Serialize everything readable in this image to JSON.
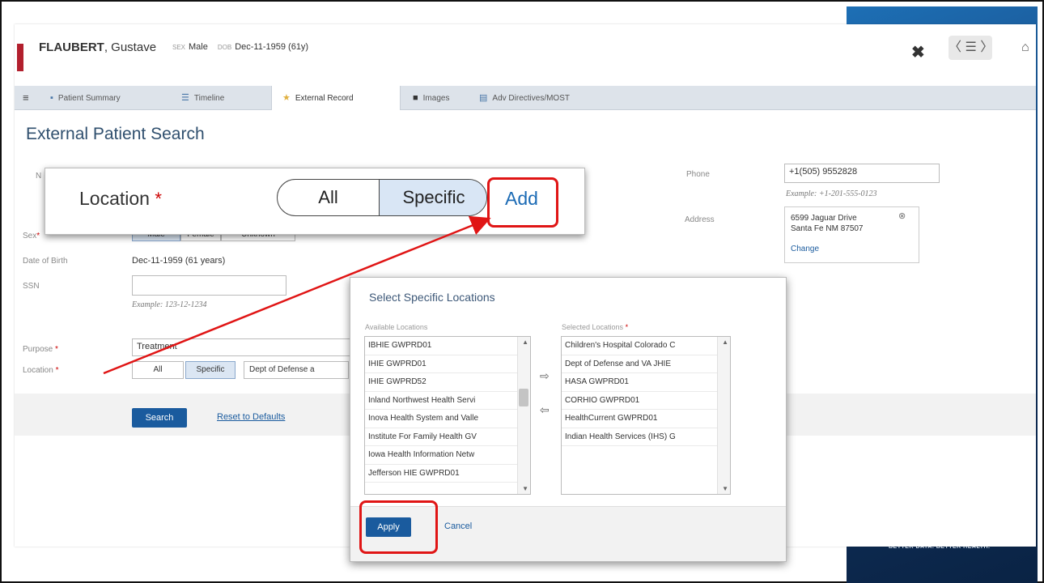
{
  "brand": {
    "tagline": "BETTER DATA. BETTER HEALTH."
  },
  "patient": {
    "last_name": "FLAUBERT",
    "first_name": "Gustave",
    "sex_label": "SEX",
    "sex": "Male",
    "dob_label": "DOB",
    "dob": "Dec-11-1959 (61y)"
  },
  "header": {
    "close_icon": "✖",
    "nav_icon": "〈 ☰ 〉",
    "home_icon": "⌂"
  },
  "tabs": [
    {
      "label": "Patient Summary",
      "icon": "person-icon"
    },
    {
      "label": "Timeline",
      "icon": "timeline-icon"
    },
    {
      "label": "External Record",
      "icon": "star-icon"
    },
    {
      "label": "Images",
      "icon": "image-icon"
    },
    {
      "label": "Adv Directives/MOST",
      "icon": "document-icon"
    }
  ],
  "page": {
    "title": "External Patient Search"
  },
  "form": {
    "name_label_fragment": "N",
    "sex_label": "Sex",
    "sex_options": [
      "Male",
      "Female",
      "Unknown"
    ],
    "dob_label": "Date of Birth",
    "dob_value": "Dec-11-1959 (61 years)",
    "ssn_label": "SSN",
    "ssn_value": "",
    "ssn_hint": "Example: 123-12-1234",
    "purpose_label": "Purpose",
    "purpose_value": "Treatment",
    "location_label": "Location",
    "location_all": "All",
    "location_specific": "Specific",
    "location_selected_chip": "Dept of Defense a",
    "phone_label": "Phone",
    "phone_value": "+1(505) 9552828",
    "phone_hint": "Example: +1-201-555-0123",
    "address_label": "Address",
    "address_line1": "6599 Jaguar Drive",
    "address_line2": "Santa Fe NM 87507",
    "address_change": "Change",
    "search_button": "Search",
    "reset_link": "Reset to Defaults"
  },
  "zoom": {
    "label": "Location",
    "all": "All",
    "specific": "Specific",
    "add": "Add"
  },
  "modal": {
    "title": "Select Specific Locations",
    "available_header": "Available Locations",
    "selected_header": "Selected Locations",
    "available": [
      "IBHIE GWPRD01",
      "IHIE GWPRD01",
      "IHIE GWPRD52",
      "Inland Northwest Health Servi",
      "Inova Health System and Valle",
      "Institute For Family Health GV",
      "Iowa Health Information Netw",
      "Jefferson HIE GWPRD01"
    ],
    "selected": [
      "Children's Hospital Colorado C",
      "Dept of Defense and VA JHIE",
      "HASA GWPRD01",
      "CORHIO GWPRD01",
      "HealthCurrent GWPRD01",
      "Indian Health Services (IHS) G"
    ],
    "apply": "Apply",
    "cancel": "Cancel"
  },
  "colors": {
    "accent": "#1a5b9e",
    "callout": "#e01515",
    "required": "#cc0000"
  }
}
